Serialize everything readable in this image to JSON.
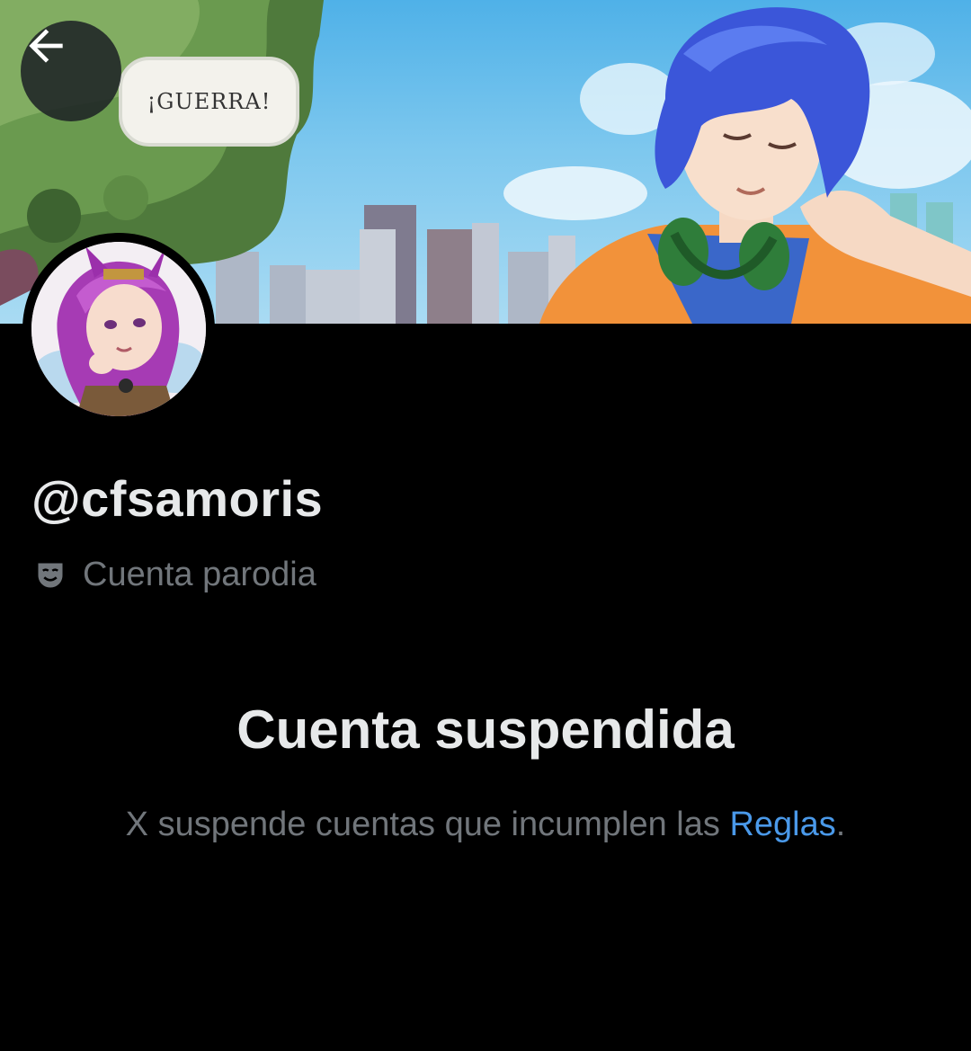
{
  "header": {
    "back_icon": "arrow-left-icon",
    "banner_speech_text": "¡GUERRA!"
  },
  "profile": {
    "handle": "@cfsamoris",
    "label_icon": "theater-mask-icon",
    "label_text": "Cuenta parodia"
  },
  "suspension": {
    "title": "Cuenta suspendida",
    "description_prefix": "X suspende cuentas que incumplen las ",
    "rules_link": "Reglas",
    "description_suffix": "."
  },
  "colors": {
    "background": "#000000",
    "primary_text": "#e7e9ea",
    "secondary_text": "#71767b",
    "link": "#4a99e9"
  }
}
